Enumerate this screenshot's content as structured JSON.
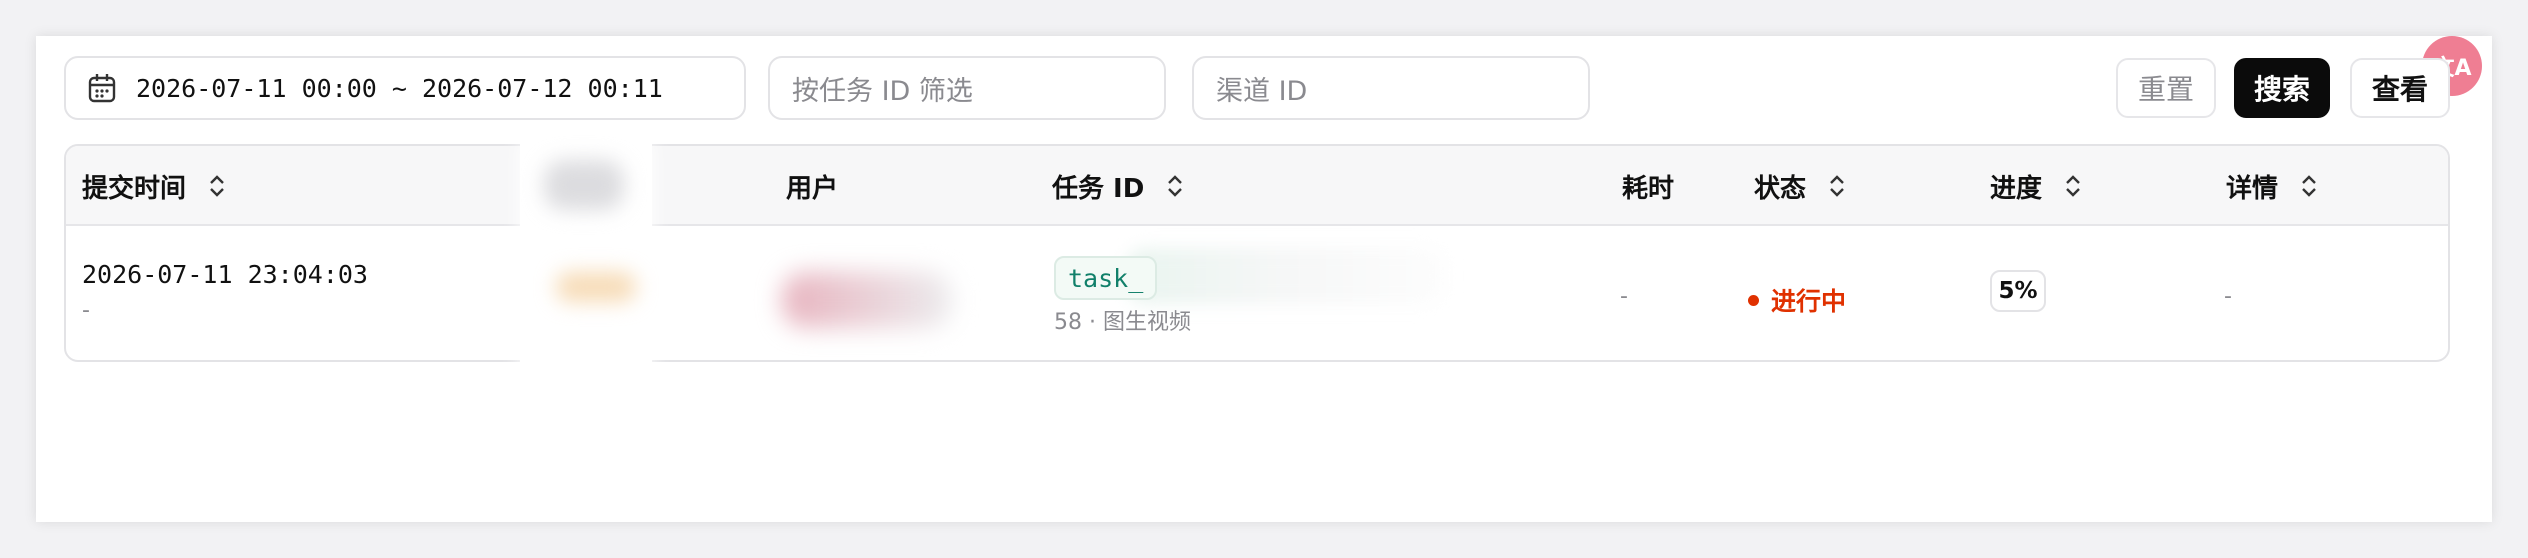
{
  "filters": {
    "date_range": "2026-07-11 00:00 ~ 2026-07-12 00:11",
    "task_id_placeholder": "按任务 ID 筛选",
    "channel_id_placeholder": "渠道 ID"
  },
  "actions": {
    "reset": "重置",
    "search": "搜索",
    "view": "查看"
  },
  "translate_badge": "文A",
  "table": {
    "columns": [
      "提交时间",
      "用户",
      "任务 ID",
      "耗时",
      "状态",
      "进度",
      "详情"
    ],
    "rows": [
      {
        "submit_time": "2026-07-11 23:04:03",
        "submit_sub": "-",
        "task_id_prefix": "task_",
        "task_meta": "58 · 图生视频",
        "duration": "-",
        "status": "进行中",
        "progress": "5%",
        "details": "-"
      }
    ]
  },
  "colors": {
    "status_in_progress": "#e03100",
    "primary_button": "#0b0b0b",
    "task_id_text": "#11806a"
  },
  "icons": [
    "calendar-icon",
    "sort-icon",
    "translate-icon"
  ]
}
